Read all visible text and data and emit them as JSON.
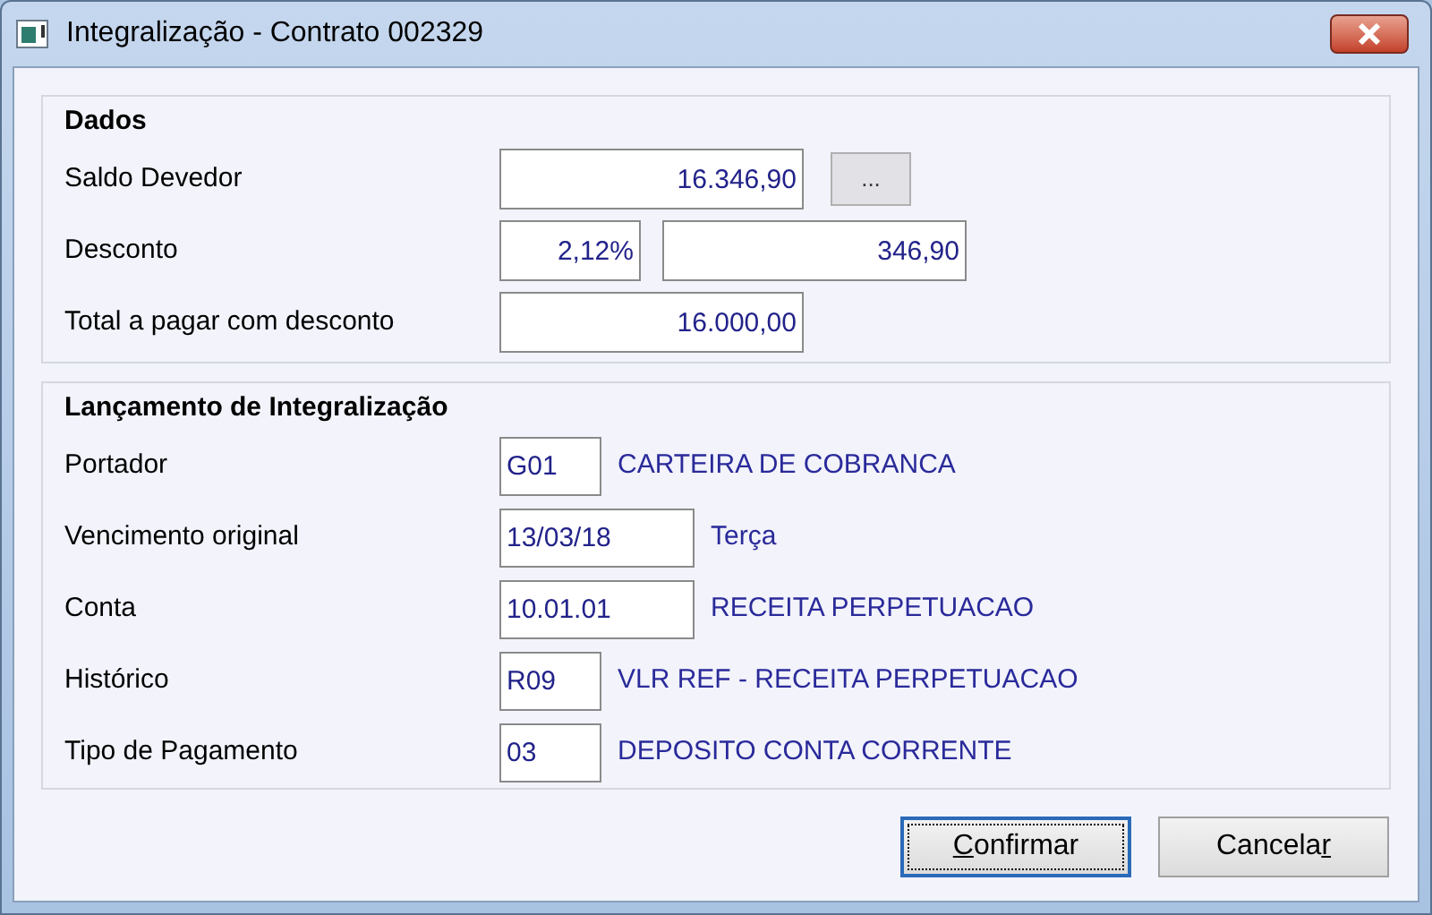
{
  "window": {
    "title": "Integralização - Contrato 002329"
  },
  "dados": {
    "title": "Dados",
    "rows": [
      {
        "label": "Saldo Devedor",
        "fields": [
          {
            "kind": "amount",
            "value": "16.346,90"
          }
        ],
        "button": "..."
      },
      {
        "label": "Desconto",
        "fields": [
          {
            "kind": "percent",
            "value": "2,12%"
          },
          {
            "kind": "amount",
            "value": "346,90"
          }
        ]
      },
      {
        "label": "Total a pagar com desconto",
        "fields": [
          {
            "kind": "amount",
            "value": "16.000,00"
          }
        ]
      }
    ]
  },
  "lancamento": {
    "title": "Lançamento de Integralização",
    "rows": [
      {
        "label": "Portador",
        "kind": "code",
        "value": "G01",
        "description": "CARTEIRA DE COBRANCA"
      },
      {
        "label": "Vencimento original",
        "kind": "date",
        "value": "13/03/18",
        "description": "Terça"
      },
      {
        "label": "Conta",
        "kind": "date",
        "value": "10.01.01",
        "description": "RECEITA PERPETUACAO"
      },
      {
        "label": "Histórico",
        "kind": "code",
        "value": "R09",
        "description": "VLR REF - RECEITA PERPETUACAO"
      },
      {
        "label": "Tipo de Pagamento",
        "kind": "code",
        "value": "03",
        "description": "DEPOSITO CONTA CORRENTE"
      }
    ]
  },
  "buttons": [
    {
      "key": "C",
      "after": "onfirmar",
      "selected": true
    },
    {
      "before": "Cancela",
      "key": "r",
      "selected": false
    }
  ]
}
